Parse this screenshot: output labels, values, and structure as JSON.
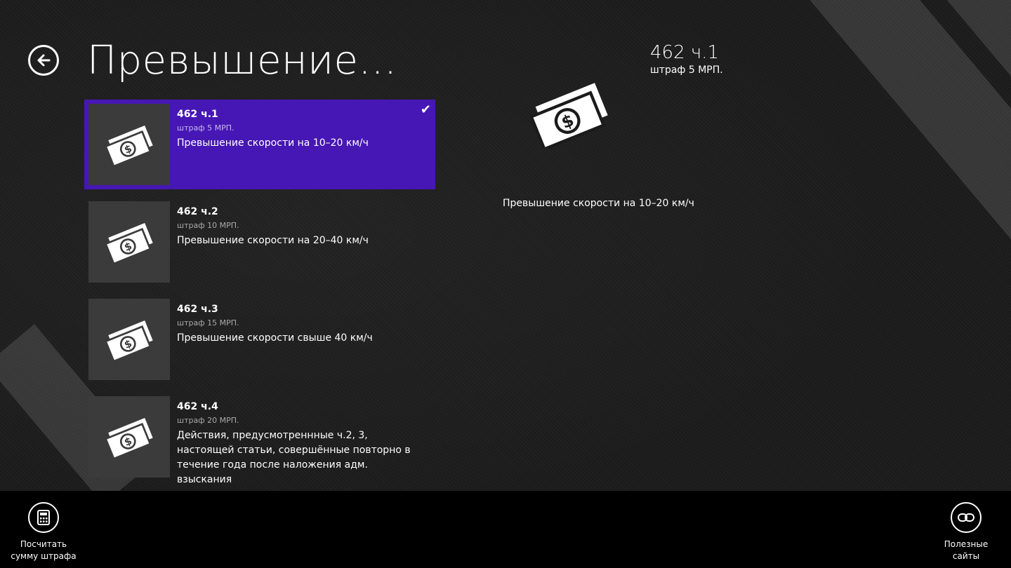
{
  "page": {
    "title": "Превышение..."
  },
  "items": [
    {
      "code": "462 ч.1",
      "fine": "штраф 5 МРП.",
      "description": "Превышение скорости на 10–20 км/ч",
      "icon": "money-icon",
      "selected": true
    },
    {
      "code": "462 ч.2",
      "fine": "штраф 10 МРП.",
      "description": "Превышение скорости на 20–40 км/ч",
      "icon": "money-icon",
      "selected": false
    },
    {
      "code": "462 ч.3",
      "fine": "штраф 15 МРП.",
      "description": "Превышение скорости свыше 40 км/ч",
      "icon": "money-icon",
      "selected": false
    },
    {
      "code": "462 ч.4",
      "fine": "штраф 20 МРП.",
      "description": "Действия, предусмотреннные ч.2, 3, настоящей статьи, совершённые повторно в течение года после наложения адм. взыскания",
      "icon": "money-icon",
      "selected": false
    }
  ],
  "detail": {
    "code": "462 ч.1",
    "fine": "штраф 5 МРП.",
    "description": "Превышение скорости на 10–20 км/ч",
    "icon": "money-icon"
  },
  "appbar": {
    "calc_label": "Посчитать\nсумму штрафа",
    "calc_icon": "calculator-icon",
    "links_label": "Полезные\nсайты",
    "links_icon": "link-icon"
  },
  "colors": {
    "accent": "#4617b4",
    "tile": "#3b3b3b",
    "appbar": "#000000"
  }
}
